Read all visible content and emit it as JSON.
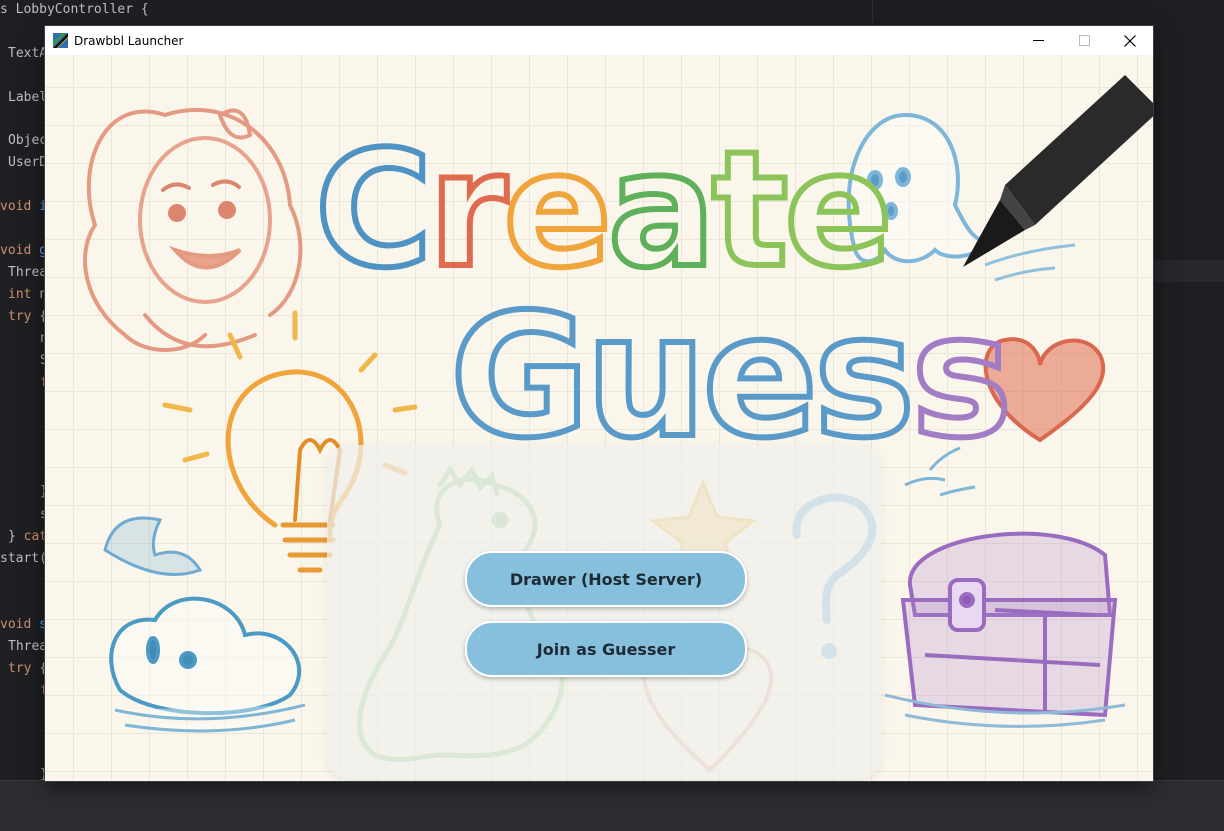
{
  "ide": {
    "code_lines": [
      {
        "parts": [
          [
            "",
            "s LobbyController {"
          ]
        ]
      },
      {
        "parts": [
          [
            "",
            "TextA"
          ]
        ]
      },
      {
        "parts": [
          [
            "",
            "Label"
          ]
        ]
      },
      {
        "parts": [
          [
            "",
            "Objec"
          ]
        ]
      },
      {
        "parts": [
          [
            "",
            "UserD"
          ]
        ]
      },
      {
        "parts": [
          [
            "kw",
            "void "
          ],
          [
            "fn",
            "i"
          ]
        ]
      },
      {
        "parts": [
          [
            "kw",
            "void "
          ],
          [
            "fn",
            "g"
          ]
        ]
      },
      {
        "parts": [
          [
            "",
            "Threa"
          ]
        ]
      },
      {
        "parts": [
          [
            "kw",
            "int "
          ],
          [
            "",
            "n"
          ]
        ]
      },
      {
        "parts": [
          [
            "kw",
            "try "
          ],
          [
            "",
            "{"
          ]
        ]
      },
      {
        "parts": [
          [
            "",
            "n"
          ]
        ]
      },
      {
        "parts": [
          [
            "",
            "S"
          ]
        ]
      },
      {
        "parts": [
          [
            "kw",
            "f"
          ]
        ]
      },
      {
        "parts": [
          [
            "",
            "}"
          ]
        ]
      },
      {
        "parts": [
          [
            "",
            "s"
          ]
        ]
      },
      {
        "parts": [
          [
            "",
            "} "
          ],
          [
            "kw",
            "cat"
          ]
        ]
      },
      {
        "parts": [
          [
            "",
            "start("
          ]
        ]
      },
      {
        "parts": [
          [
            "kw",
            "void "
          ],
          [
            "fn",
            "s"
          ]
        ]
      },
      {
        "parts": [
          [
            "",
            "Threa"
          ]
        ]
      },
      {
        "parts": [
          [
            "kw",
            "try "
          ],
          [
            "",
            "{"
          ]
        ]
      },
      {
        "parts": [
          [
            "kw",
            "f"
          ]
        ]
      },
      {
        "parts": [
          [
            "",
            "}"
          ]
        ]
      }
    ]
  },
  "window": {
    "title": "Drawbbl Launcher",
    "controls": [
      "minimize-icon",
      "maximize-icon",
      "close-icon"
    ]
  },
  "art": {
    "title_line1": "Create",
    "title_line2": "Guess",
    "title_colors": [
      "#4f93c4",
      "#e06a4e",
      "#f0a43c",
      "#5fb05a",
      "#8cc45a",
      "#8cc45a"
    ],
    "guess_color": "#5a9ac8",
    "guess_last_color": "#a27cc4"
  },
  "panel": {
    "host_button_label": "Drawer (Host Server)",
    "guesser_button_label": "Join as Guesser"
  }
}
